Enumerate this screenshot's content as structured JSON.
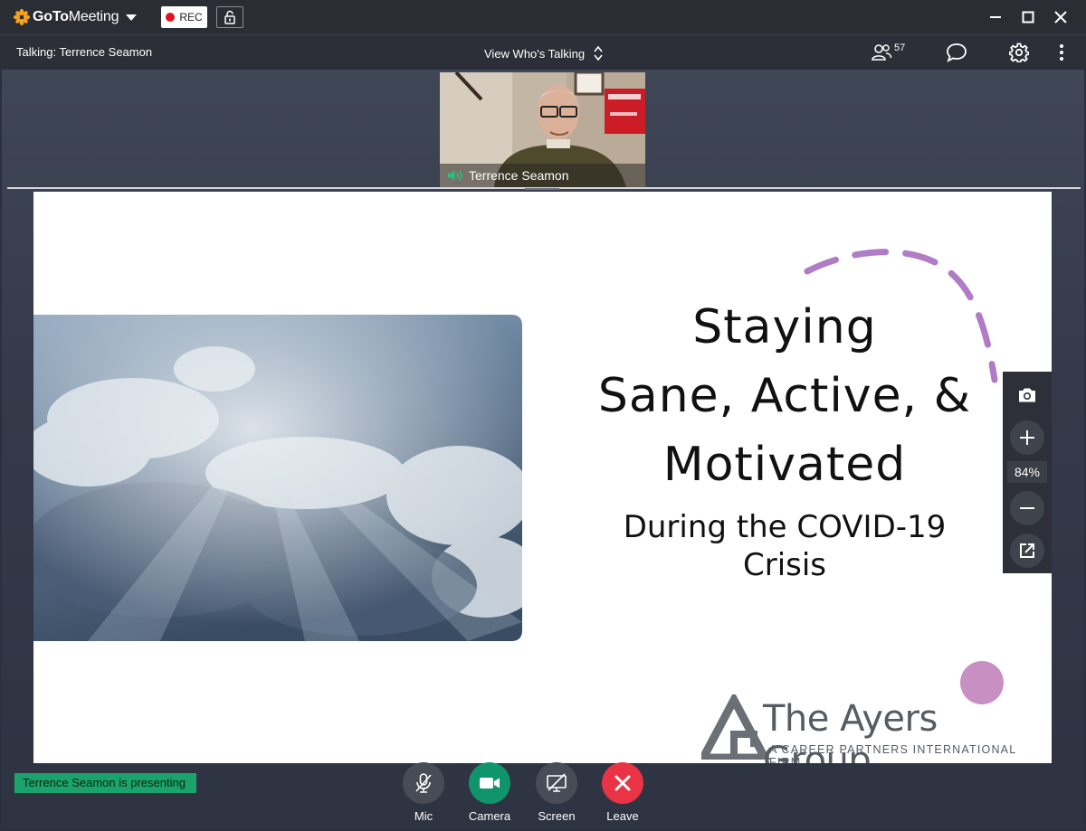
{
  "app": {
    "brand": "GoToMeeting",
    "brand_bold": "GoTo",
    "brand_light": "Meeting"
  },
  "titlebar": {
    "rec_label": "REC"
  },
  "toolbar": {
    "talking": "Talking: Terrence Seamon",
    "view_who": "View Who's Talking",
    "attendee_count": "57"
  },
  "video": {
    "participant_name": "Terrence Seamon"
  },
  "slide": {
    "title_lines": [
      "Staying",
      "Sane, Active, &",
      "Motivated"
    ],
    "subtitle_lines": [
      "During the COVID-19",
      "Crisis"
    ],
    "logo_name": "The Ayers Group",
    "logo_tagline": "A CAREER PARTNERS INTERNATIONAL FIRM"
  },
  "zoom": {
    "level": "84%"
  },
  "status": {
    "presenting": "Terrence Seamon is presenting"
  },
  "controls": {
    "mic": "Mic",
    "camera": "Camera",
    "screen": "Screen",
    "leave": "Leave"
  },
  "colors": {
    "brand_orange": "#f7a21b",
    "rec_red": "#e0141e",
    "camera_green": "#10946b",
    "leave_red": "#e93445",
    "presenting_green": "#1aa36a",
    "slide_accent_purple": "#b07cc6"
  }
}
